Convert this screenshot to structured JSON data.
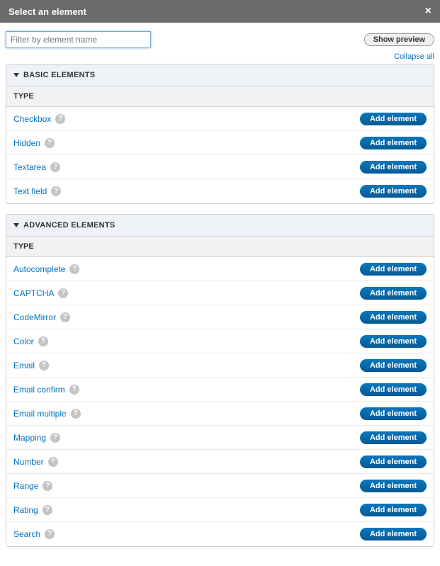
{
  "dialog": {
    "title": "Select an element",
    "close_glyph": "×"
  },
  "filter": {
    "placeholder": "Filter by element name",
    "value": ""
  },
  "buttons": {
    "show_preview": "Show preview",
    "collapse_all": "Collapse all",
    "add_element": "Add element"
  },
  "column_header": "TYPE",
  "help_glyph": "?",
  "groups": [
    {
      "title": "BASIC ELEMENTS",
      "items": [
        {
          "name": "Checkbox"
        },
        {
          "name": "Hidden"
        },
        {
          "name": "Textarea"
        },
        {
          "name": "Text field"
        }
      ]
    },
    {
      "title": "ADVANCED ELEMENTS",
      "items": [
        {
          "name": "Autocomplete"
        },
        {
          "name": "CAPTCHA"
        },
        {
          "name": "CodeMirror"
        },
        {
          "name": "Color"
        },
        {
          "name": "Email"
        },
        {
          "name": "Email confirm"
        },
        {
          "name": "Email multiple"
        },
        {
          "name": "Mapping"
        },
        {
          "name": "Number"
        },
        {
          "name": "Range"
        },
        {
          "name": "Rating"
        },
        {
          "name": "Search"
        }
      ]
    }
  ]
}
